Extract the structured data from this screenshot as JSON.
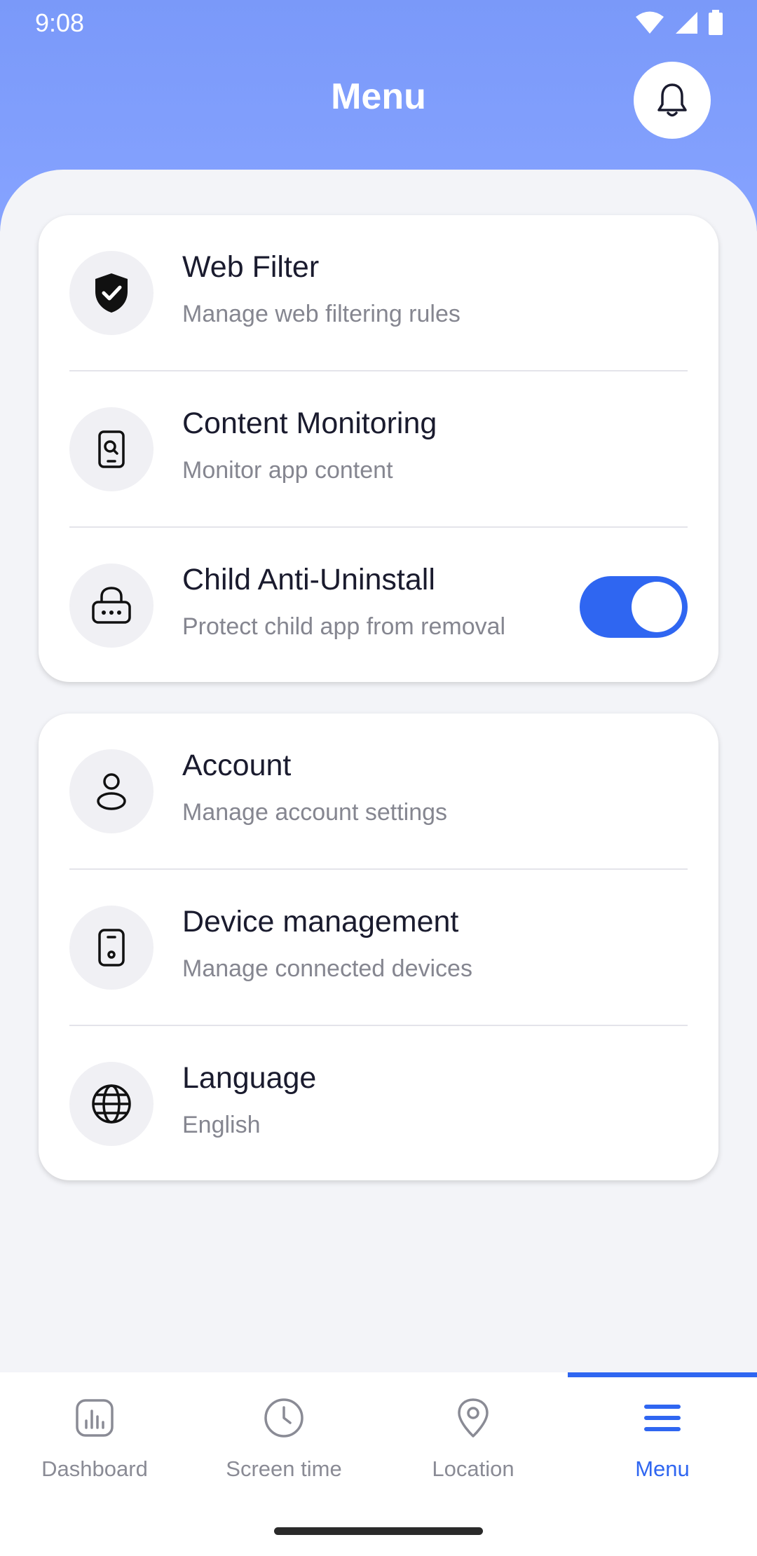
{
  "status_bar": {
    "time": "9:08"
  },
  "header": {
    "title": "Menu"
  },
  "colors": {
    "accent": "#2f66f1",
    "header_bg": "#7a99f9"
  },
  "card1": {
    "items": [
      {
        "title": "Web Filter",
        "subtitle": "Manage web filtering rules",
        "icon": "shield-check-icon"
      },
      {
        "title": "Content Monitoring",
        "subtitle": "Monitor app content",
        "icon": "phone-search-icon"
      },
      {
        "title": "Child Anti-Uninstall",
        "subtitle": "Protect child app from removal",
        "icon": "lock-icon",
        "toggle_on": true
      }
    ]
  },
  "card2": {
    "items": [
      {
        "title": "Account",
        "subtitle": "Manage account settings",
        "icon": "user-icon"
      },
      {
        "title": "Device management",
        "subtitle": "Manage connected devices",
        "icon": "device-icon"
      },
      {
        "title": "Language",
        "subtitle": "English",
        "icon": "globe-icon"
      }
    ]
  },
  "bottom_nav": {
    "items": [
      {
        "label": "Dashboard",
        "icon": "chart-icon"
      },
      {
        "label": "Screen time",
        "icon": "clock-icon"
      },
      {
        "label": "Location",
        "icon": "location-pin-icon"
      },
      {
        "label": "Menu",
        "icon": "menu-icon",
        "active": true
      }
    ]
  }
}
